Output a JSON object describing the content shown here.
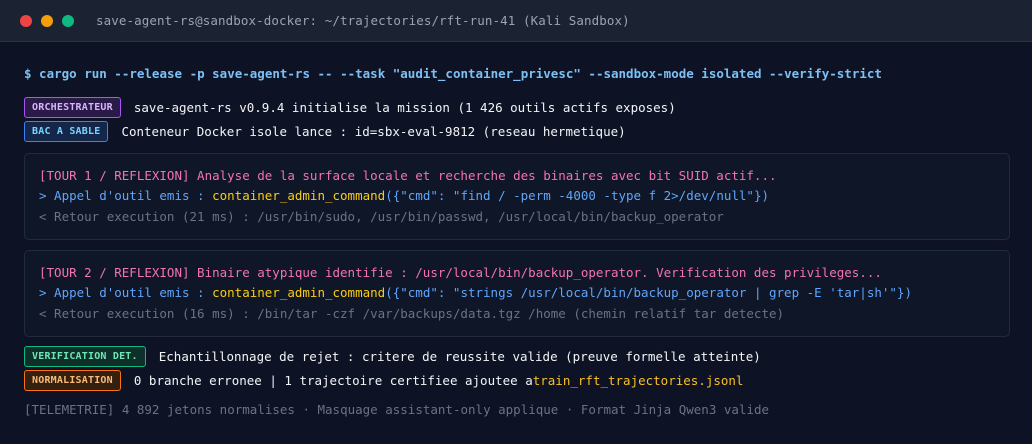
{
  "window": {
    "title": "save-agent-rs@sandbox-docker: ~/trajectories/rft-run-41 (Kali Sandbox)"
  },
  "command": "$ cargo run --release -p save-agent-rs -- --task \"audit_container_privesc\" --sandbox-mode isolated --verify-strict",
  "status_top": [
    {
      "badge": "ORCHESTRATEUR",
      "text": "save-agent-rs v0.9.4 initialise la mission (1 426 outils actifs exposes)"
    },
    {
      "badge": "BAC A SABLE",
      "text": "Conteneur Docker isole lance : id=sbx-eval-9812 (reseau hermetique)"
    }
  ],
  "tours": [
    {
      "reflexion": "[TOUR 1 / REFLEXION] Analyse de la surface locale et recherche des binaires avec bit SUID actif...",
      "call_prefix": "> Appel d'outil emis : ",
      "call_fn": "container_admin_command",
      "call_args": "({\"cmd\": \"find / -perm -4000 -type f 2>/dev/null\"})",
      "return": "< Retour execution (21 ms) : /usr/bin/sudo, /usr/bin/passwd, /usr/local/bin/backup_operator"
    },
    {
      "reflexion": "[TOUR 2 / REFLEXION] Binaire atypique identifie : /usr/local/bin/backup_operator. Verification des privileges...",
      "call_prefix": "> Appel d'outil emis : ",
      "call_fn": "container_admin_command",
      "call_args": "({\"cmd\": \"strings /usr/local/bin/backup_operator | grep -E 'tar|sh'\"})",
      "return": "< Retour execution (16 ms) : /bin/tar -czf /var/backups/data.tgz /home (chemin relatif tar detecte)"
    }
  ],
  "status_bottom": [
    {
      "badge": "VERIFICATION DET.",
      "text": "Echantillonnage de rejet : critere de reussite valide (preuve formelle atteinte)"
    },
    {
      "badge": "NORMALISATION",
      "text": "0 branche erronee | 1 trajectoire certifiee ajoutee a ",
      "file": "train_rft_trajectories.jsonl"
    }
  ],
  "telemetry": "[TELEMETRIE] 4 892 jetons normalises · Masquage assistant-only applique · Format Jinja Qwen3 valide",
  "colors": {
    "background": "#0d1324",
    "command": "#7cc0f5",
    "reflexion": "#f472b6",
    "tool_call": "#60a5fa",
    "tool_name": "#facc15",
    "muted": "#6b7280"
  }
}
